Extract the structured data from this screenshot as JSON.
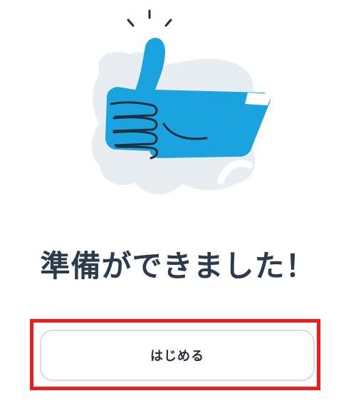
{
  "onboarding": {
    "title": "準備ができました！",
    "start_button_label": "はじめる"
  },
  "illustration": {
    "icon": "thumbs-up-icon",
    "hand_color": "#1aa3df",
    "background_blob_color": "#e8edf2",
    "outline_color": "#1f2f3f"
  },
  "highlight": {
    "color": "#ee1c1c"
  }
}
